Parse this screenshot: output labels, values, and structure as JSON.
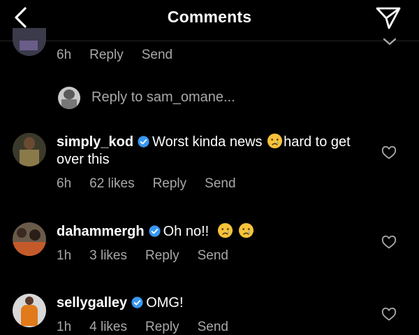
{
  "header": {
    "title": "Comments",
    "back_icon": "chevron-left-icon",
    "send_icon": "paper-plane-icon"
  },
  "partial_comment": {
    "time": "6h",
    "reply": "Reply",
    "send": "Send"
  },
  "reply_composer": {
    "placeholder": "Reply to sam_omane..."
  },
  "comments": [
    {
      "username": "simply_kod",
      "verified": true,
      "text_before_emoji": "Worst kinda news",
      "emoji": "crying-face",
      "text_after_emoji": "hard to get over this",
      "time": "6h",
      "likes": "62 likes",
      "reply": "Reply",
      "send": "Send"
    },
    {
      "username": "dahammergh",
      "verified": true,
      "text": "Oh no!!",
      "emoji": [
        "crying-face",
        "crying-face"
      ],
      "time": "1h",
      "likes": "3 likes",
      "reply": "Reply",
      "send": "Send"
    },
    {
      "username": "sellygalley",
      "verified": true,
      "text": "OMG!",
      "time": "1h",
      "likes": "4 likes",
      "reply": "Reply",
      "send": "Send"
    }
  ],
  "colors": {
    "background": "#000000",
    "text": "#ffffff",
    "secondary_text": "#a8a8a8",
    "verified_badge": "#3897f0",
    "emoji": "#f7c23a"
  }
}
